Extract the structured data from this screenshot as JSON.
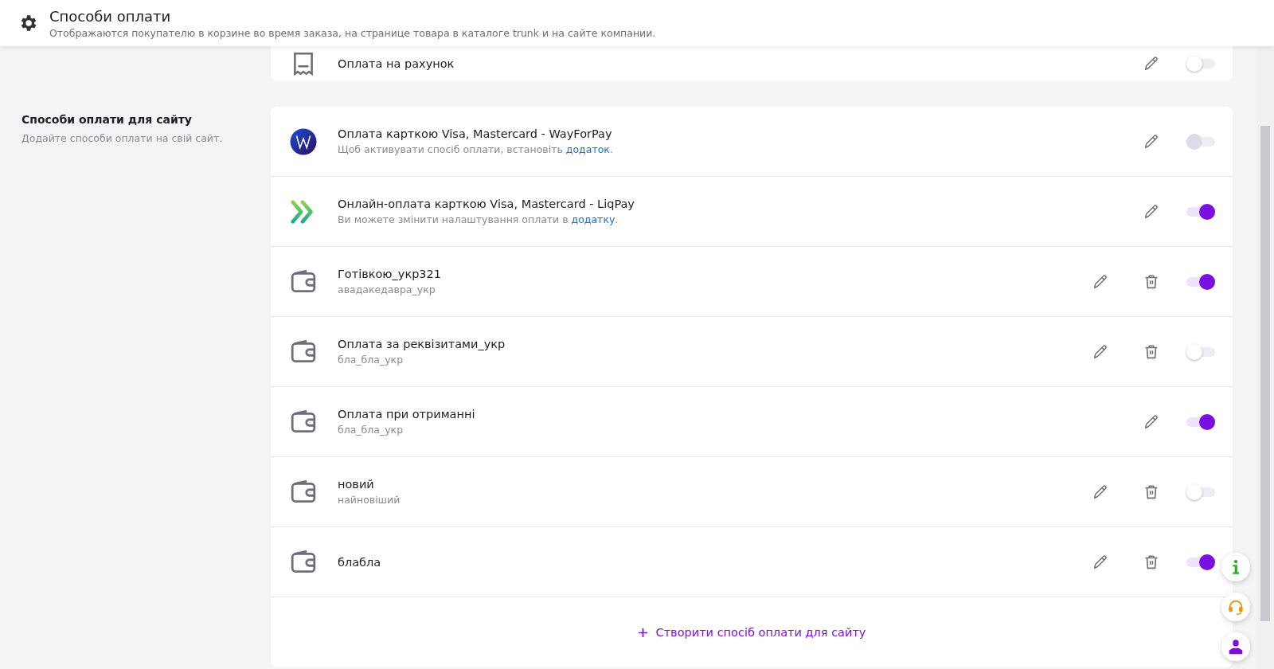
{
  "header": {
    "title": "Способи оплати",
    "subtitle": "Отображаются покупателю в корзине во время заказа, на странице товара в каталоге trunk и на сайте компании."
  },
  "top_card": {
    "rows": [
      {
        "kind": "receipt",
        "title": "Оплата на рахунок",
        "deletable": false,
        "on": false
      }
    ]
  },
  "site_section": {
    "title": "Способи оплати для сайту",
    "description": "Додайте способи оплати на свій сайт.",
    "rows": [
      {
        "kind": "wayforpay",
        "title": "Оплата карткою Visa, Mastercard - WayForPay",
        "subtitle": [
          {
            "text": "Щоб активувати спосіб оплати, встановіть "
          },
          {
            "text": "додаток",
            "link": true
          },
          {
            "text": "."
          }
        ],
        "deletable": false,
        "on": false,
        "disabled": true
      },
      {
        "kind": "liqpay",
        "title": "Онлайн-оплата карткою Visa, Mastercard - LiqPay",
        "subtitle": [
          {
            "text": "Ви можете змінити налаштування оплати в "
          },
          {
            "text": "додатку",
            "link": true
          },
          {
            "text": "."
          }
        ],
        "deletable": false,
        "on": true,
        "disabled": false
      },
      {
        "kind": "wallet",
        "title": "Готівкою_укр321",
        "subtitle": [
          {
            "text": "авадакедавра_укр"
          }
        ],
        "deletable": true,
        "on": true,
        "disabled": false
      },
      {
        "kind": "wallet",
        "title": "Оплата за реквізитами_укр",
        "subtitle": [
          {
            "text": "бла_бла_укр"
          }
        ],
        "deletable": true,
        "on": false,
        "disabled": false
      },
      {
        "kind": "wallet",
        "title": "Оплата при отриманні",
        "subtitle": [
          {
            "text": "бла_бла_укр"
          }
        ],
        "deletable": false,
        "on": true,
        "disabled": false
      },
      {
        "kind": "wallet",
        "title": "новий",
        "subtitle": [
          {
            "text": "найновіший"
          }
        ],
        "deletable": true,
        "on": false,
        "disabled": false
      },
      {
        "kind": "wallet",
        "title": "блабла",
        "deletable": true,
        "on": true,
        "disabled": false
      }
    ],
    "create_label": "Створити спосіб оплати для сайту"
  }
}
